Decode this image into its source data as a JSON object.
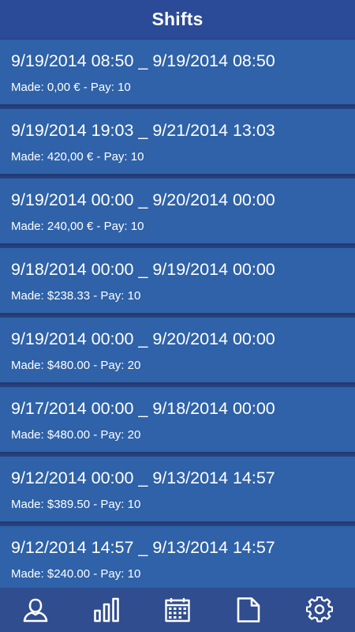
{
  "header": {
    "title": "Shifts"
  },
  "shifts": [
    {
      "range": "9/19/2014 08:50 _ 9/19/2014 08:50",
      "made": "0,00 €",
      "pay": "10"
    },
    {
      "range": "9/19/2014 19:03 _ 9/21/2014 13:03",
      "made": "420,00 €",
      "pay": "10"
    },
    {
      "range": "9/19/2014 00:00 _ 9/20/2014 00:00",
      "made": "240,00 €",
      "pay": "10"
    },
    {
      "range": "9/18/2014 00:00 _ 9/19/2014 00:00",
      "made": "$238.33",
      "pay": "10"
    },
    {
      "range": "9/19/2014 00:00 _ 9/20/2014 00:00",
      "made": "$480.00",
      "pay": "20"
    },
    {
      "range": "9/17/2014 00:00 _ 9/18/2014 00:00",
      "made": "$480.00",
      "pay": "20"
    },
    {
      "range": "9/12/2014 00:00 _ 9/13/2014 14:57",
      "made": "$389.50",
      "pay": "10"
    },
    {
      "range": "9/12/2014 14:57 _ 9/13/2014 14:57",
      "made": "$240.00",
      "pay": "10"
    }
  ],
  "labels": {
    "made_prefix": "Made: ",
    "pay_prefix": " - Pay: "
  },
  "bottom_nav": [
    {
      "name": "profile",
      "icon": "user-icon"
    },
    {
      "name": "stats",
      "icon": "bar-chart-icon"
    },
    {
      "name": "calendar",
      "icon": "calendar-icon"
    },
    {
      "name": "notes",
      "icon": "document-icon"
    },
    {
      "name": "settings",
      "icon": "gear-icon"
    }
  ],
  "colors": {
    "header_bg": "#2b4a97",
    "row_bg": "#2f62a8",
    "row_separator": "#243a74",
    "nav_bg": "#2f4d8f",
    "text": "#ffffff"
  }
}
